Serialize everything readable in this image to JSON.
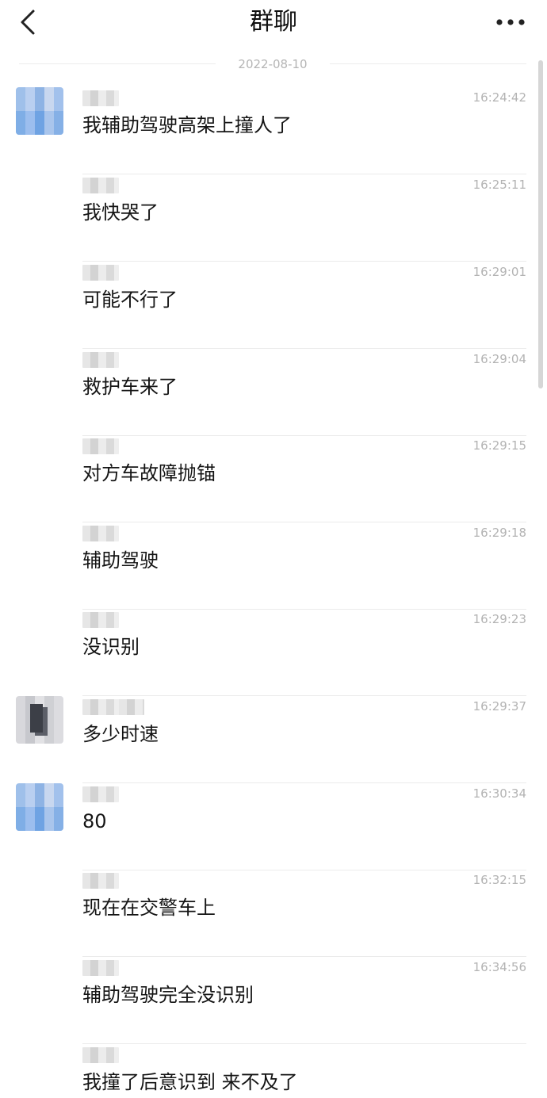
{
  "header": {
    "title": "群聊",
    "back_icon": "chevron-left-icon",
    "more_icon": "more-horizontal-icon"
  },
  "date_separator": "2022-08-10",
  "messages": [
    {
      "time": "16:24:42",
      "text": "我辅助驾驶高架上撞人了",
      "avatar": "blue"
    },
    {
      "time": "16:25:11",
      "text": "我快哭了",
      "avatar": ""
    },
    {
      "time": "16:29:01",
      "text": "可能不行了",
      "avatar": ""
    },
    {
      "time": "16:29:04",
      "text": "救护车来了",
      "avatar": ""
    },
    {
      "time": "16:29:15",
      "text": "对方车故障抛锚",
      "avatar": ""
    },
    {
      "time": "16:29:18",
      "text": "辅助驾驶",
      "avatar": ""
    },
    {
      "time": "16:29:23",
      "text": "没识别",
      "avatar": ""
    },
    {
      "time": "16:29:37",
      "text": "多少时速",
      "avatar": "gray"
    },
    {
      "time": "16:30:34",
      "text": "80",
      "avatar": "blue"
    },
    {
      "time": "16:32:15",
      "text": "现在在交警车上",
      "avatar": ""
    },
    {
      "time": "16:34:56",
      "text": "辅助驾驶完全没识别",
      "avatar": ""
    },
    {
      "time": "",
      "text": "我撞了后意识到 来不及了",
      "avatar": ""
    }
  ]
}
